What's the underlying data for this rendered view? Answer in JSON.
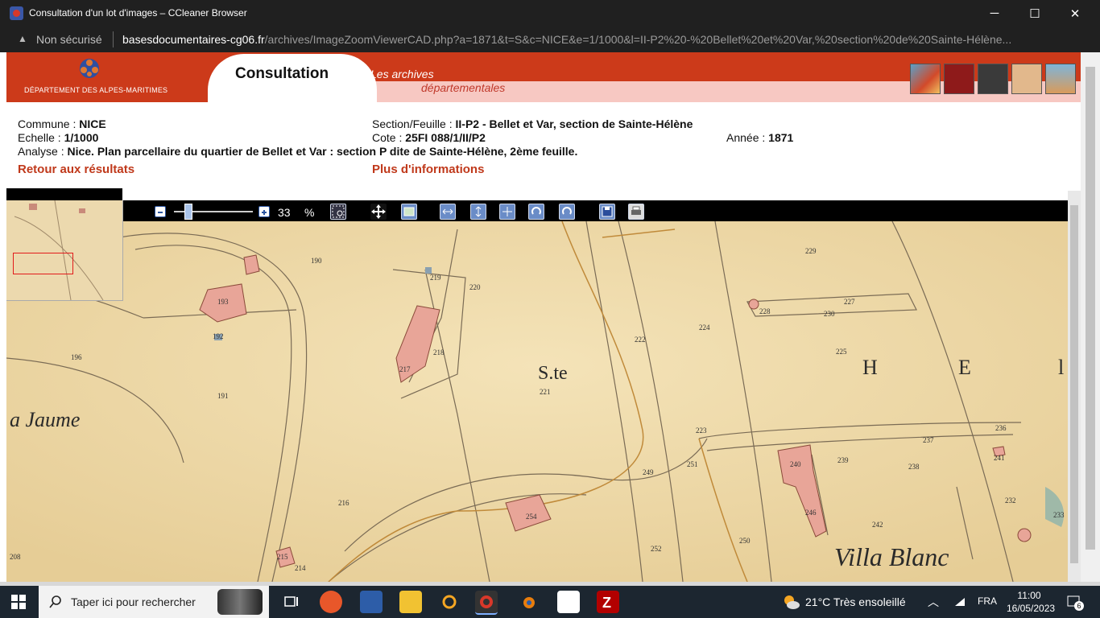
{
  "window": {
    "title": "Consultation d'un lot d'images – CCleaner Browser",
    "minimize": "─",
    "maximize": "☐",
    "close": "✕"
  },
  "address": {
    "security_label": "Non sécurisé",
    "url_host": "basesdocumentaires-cg06.fr",
    "url_path": "/archives/ImageZoomViewerCAD.php?a=1871&t=S&c=NICE&e=1/1000&l=II-P2%20-%20Bellet%20et%20Var,%20section%20de%20Sainte-Hélène..."
  },
  "banner": {
    "dept_name": "DÉPARTEMENT DES ALPES-MARITIMES",
    "tab_title": "Consultation",
    "archives_line1": "Les archives",
    "archives_line2": "départementales"
  },
  "record": {
    "commune_label": "Commune :",
    "commune_value": "NICE",
    "echelle_label": "Echelle :",
    "echelle_value": "1/1000",
    "analyse_label": "Analyse :",
    "analyse_value": "Nice. Plan parcellaire du quartier de Bellet et Var : section P dite de Sainte-Hélène, 2ème feuille.",
    "section_label": "Section/Feuille :",
    "section_value": "II-P2 - Bellet et Var, section de Sainte-Hélène",
    "cote_label": "Cote :",
    "cote_value": "25FI 088/1/II/P2",
    "annee_label": "Année :",
    "annee_value": "1871",
    "back_link": "Retour aux résultats",
    "more_link": "Plus d'informations"
  },
  "toolbar": {
    "zoom_value": "33",
    "zoom_unit": "%",
    "zoom_fraction": 0.33
  },
  "map": {
    "labels": {
      "jaume": "a  Jaume",
      "ste": "S.te",
      "h": "H",
      "e": "E",
      "l": "l",
      "villa": "Villa  Blanc",
      "p190": "190",
      "p193": "193",
      "p192": "192",
      "p196": "196",
      "p191": "191",
      "p219": "219",
      "p220": "220",
      "p217": "217",
      "p218": "218",
      "p221": "221",
      "p222": "222",
      "p224": "224",
      "p229": "229",
      "p225": "225",
      "p227": "227",
      "p228": "228",
      "p230": "230",
      "p236": "236",
      "p237": "237",
      "p238": "238",
      "p239": "239",
      "p240": "240",
      "p241": "241",
      "p242": "242",
      "p232": "232",
      "p233": "233",
      "p223": "223",
      "p251": "251",
      "p249": "249",
      "p254": "254",
      "p252": "252",
      "p216": "216",
      "p215": "215",
      "p214": "214",
      "p208": "208",
      "p250": "250",
      "p246": "246"
    }
  },
  "taskbar": {
    "search_placeholder": "Taper ici pour rechercher",
    "temperature": "21°C",
    "weather_text": "Très ensoleillé",
    "language": "FRA",
    "time": "11:00",
    "date": "16/05/2023",
    "notifications": "6"
  }
}
